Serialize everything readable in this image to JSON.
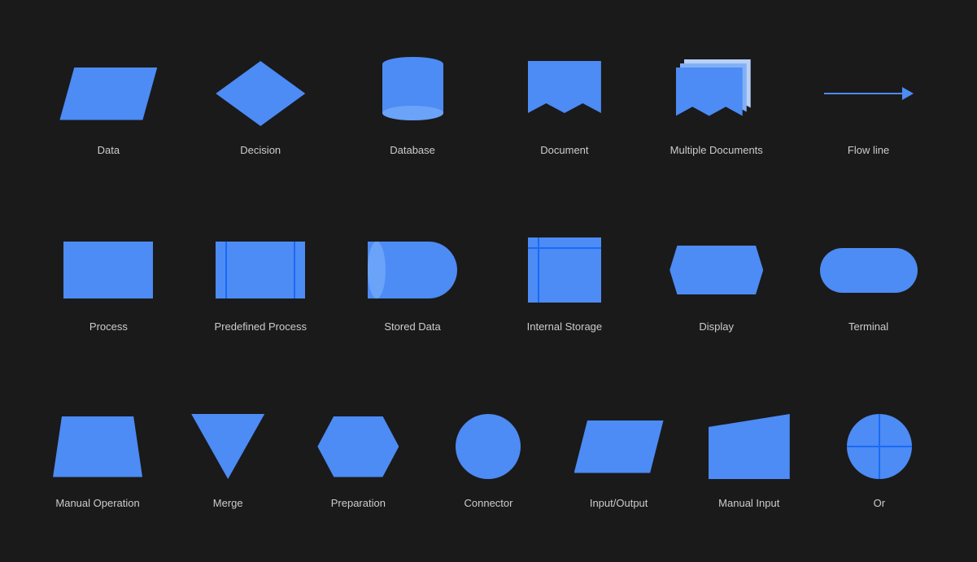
{
  "rows": [
    {
      "items": [
        {
          "id": "data",
          "label": "Data"
        },
        {
          "id": "decision",
          "label": "Decision"
        },
        {
          "id": "database",
          "label": "Database"
        },
        {
          "id": "document",
          "label": "Document"
        },
        {
          "id": "multiple-documents",
          "label": "Multiple Documents"
        },
        {
          "id": "flow-line",
          "label": "Flow line"
        }
      ]
    },
    {
      "items": [
        {
          "id": "process",
          "label": "Process"
        },
        {
          "id": "predefined-process",
          "label": "Predefined Process"
        },
        {
          "id": "stored-data",
          "label": "Stored Data"
        },
        {
          "id": "internal-storage",
          "label": "Internal Storage"
        },
        {
          "id": "display",
          "label": "Display"
        },
        {
          "id": "terminal",
          "label": "Terminal"
        }
      ]
    },
    {
      "items": [
        {
          "id": "manual-operation",
          "label": "Manual Operation"
        },
        {
          "id": "merge",
          "label": "Merge"
        },
        {
          "id": "preparation",
          "label": "Preparation"
        },
        {
          "id": "connector",
          "label": "Connector"
        },
        {
          "id": "input-output",
          "label": "Input/Output"
        },
        {
          "id": "manual-input",
          "label": "Manual Input"
        },
        {
          "id": "or",
          "label": "Or"
        }
      ]
    }
  ]
}
